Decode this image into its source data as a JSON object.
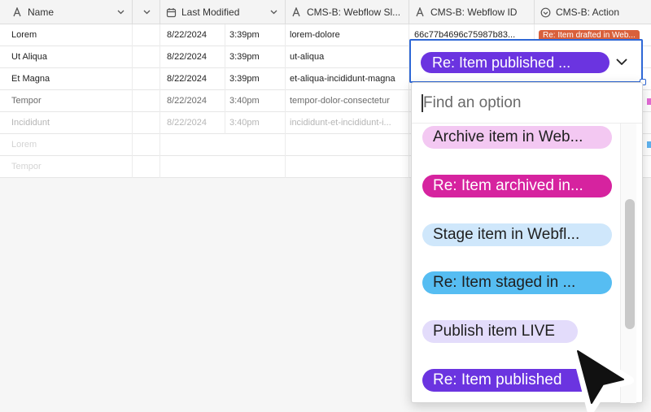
{
  "columns": [
    {
      "label": "Name",
      "icon": "text-field-icon"
    },
    {
      "label": "",
      "icon": ""
    },
    {
      "label": "Last Modified",
      "icon": "calendar-edit-icon"
    },
    {
      "label": "CMS-B: Webflow Sl...",
      "icon": "text-field-icon"
    },
    {
      "label": "CMS-B: Webflow ID",
      "icon": "text-field-icon"
    },
    {
      "label": "CMS-B: Action",
      "icon": "single-select-icon"
    }
  ],
  "rows": [
    {
      "name": "Lorem",
      "date": "8/22/2024",
      "time": "3:39pm",
      "slug": "lorem-dolore",
      "webflow_id": "66c77b4696c75987b83...",
      "action": "Re: Item drafted in Web..."
    },
    {
      "name": "Ut Aliqua",
      "date": "8/22/2024",
      "time": "3:39pm",
      "slug": "ut-aliqua",
      "webflow_id": "",
      "action": ""
    },
    {
      "name": "Et Magna",
      "date": "8/22/2024",
      "time": "3:39pm",
      "slug": "et-aliqua-incididunt-magna",
      "webflow_id": "",
      "action": ""
    },
    {
      "name": "Tempor",
      "date": "8/22/2024",
      "time": "3:40pm",
      "slug": "tempor-dolor-consectetur",
      "webflow_id": "",
      "action": ""
    },
    {
      "name": "Incididunt",
      "date": "8/22/2024",
      "time": "3:40pm",
      "slug": "incididunt-et-incididunt-i...",
      "webflow_id": "",
      "action": ""
    },
    {
      "name": "Lorem",
      "date": "",
      "time": "",
      "slug": "",
      "webflow_id": "",
      "action": ""
    },
    {
      "name": "Tempor",
      "date": "",
      "time": "",
      "slug": "",
      "webflow_id": "",
      "action": ""
    }
  ],
  "dropdown": {
    "selected": "Re: Item published ...",
    "search_placeholder": "Find an option",
    "options": [
      {
        "label": "Archive item in Web...",
        "bg": "#f3c8f2",
        "fg": "#1f1f1f"
      },
      {
        "label": "Re: Item archived in...",
        "bg": "#d6239f",
        "fg": "#ffffff"
      },
      {
        "label": "Stage item in Webfl...",
        "bg": "#cfe7fb",
        "fg": "#1f1f1f"
      },
      {
        "label": "Re: Item staged in ...",
        "bg": "#56bdf2",
        "fg": "#1f1f1f"
      },
      {
        "label": "Publish item LIVE",
        "bg": "#e3dcfb",
        "fg": "#1f1f1f"
      },
      {
        "label": "Re: Item published",
        "bg": "#6b34e0",
        "fg": "#ffffff"
      }
    ]
  },
  "colors": {
    "accent": "#2f68d6",
    "selected_pill": "#6b34e0",
    "drafted_badge": "#d9603b"
  }
}
